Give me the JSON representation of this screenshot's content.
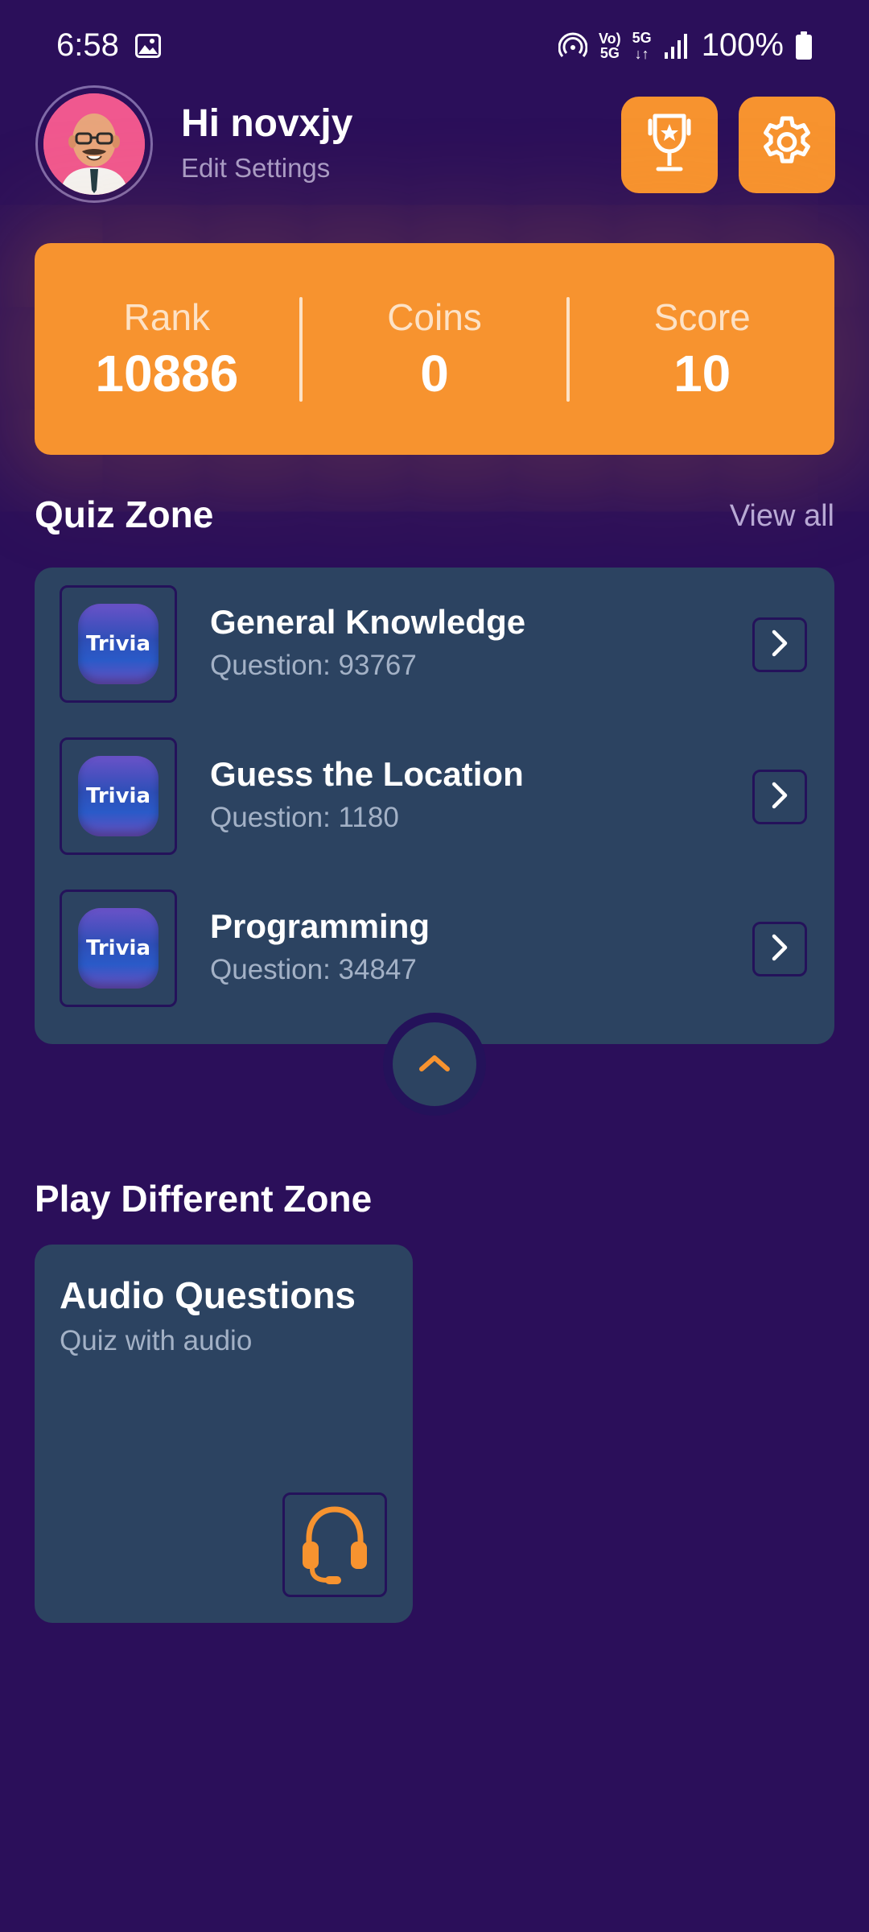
{
  "status_bar": {
    "time": "6:58",
    "battery": "100%",
    "network": "5G"
  },
  "header": {
    "greeting": "Hi novxjy",
    "edit_settings": "Edit Settings"
  },
  "stats": {
    "rank_label": "Rank",
    "rank_value": "10886",
    "coins_label": "Coins",
    "coins_value": "0",
    "score_label": "Score",
    "score_value": "10"
  },
  "quiz_zone": {
    "title": "Quiz Zone",
    "view_all": "View all",
    "thumb_text": "Trivia",
    "items": [
      {
        "name": "General Knowledge",
        "count": "Question: 93767"
      },
      {
        "name": "Guess the Location",
        "count": "Question: 1180"
      },
      {
        "name": "Programming",
        "count": "Question: 34847"
      }
    ]
  },
  "play_zone": {
    "title": "Play Different Zone",
    "card_title": "Audio Questions",
    "card_subtitle": "Quiz with audio"
  },
  "colors": {
    "background": "#2b0f5a",
    "accent": "#f7932f",
    "card": "#2c4361"
  }
}
